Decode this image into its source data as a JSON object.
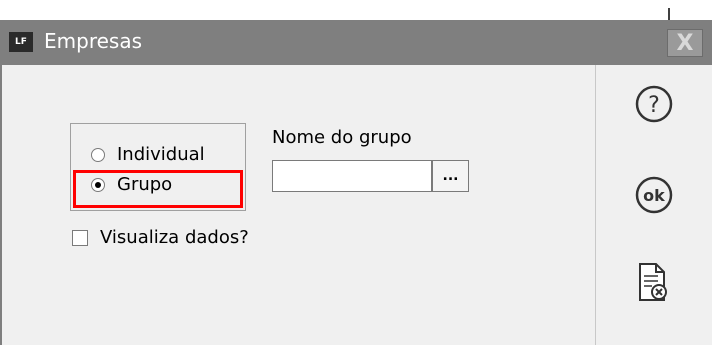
{
  "window": {
    "app_icon_text": "LF",
    "title": "Empresas",
    "close_glyph": "X"
  },
  "form": {
    "mode_options": [
      {
        "label": "Individual",
        "checked": false
      },
      {
        "label": "Grupo",
        "checked": true
      }
    ],
    "group_name_label": "Nome do grupo",
    "group_name_value": "",
    "browse_button_label": "...",
    "visualize_label": "Visualiza dados?",
    "visualize_checked": false
  },
  "sidebar": {
    "buttons": [
      {
        "icon": "help-icon",
        "text": "?"
      },
      {
        "icon": "ok-icon",
        "text": "ok"
      },
      {
        "icon": "cancel-document-icon",
        "text": ""
      }
    ]
  },
  "colors": {
    "titlebar": "#7f7f7f",
    "highlight": "#ff0000",
    "background": "#f0f0f0"
  }
}
